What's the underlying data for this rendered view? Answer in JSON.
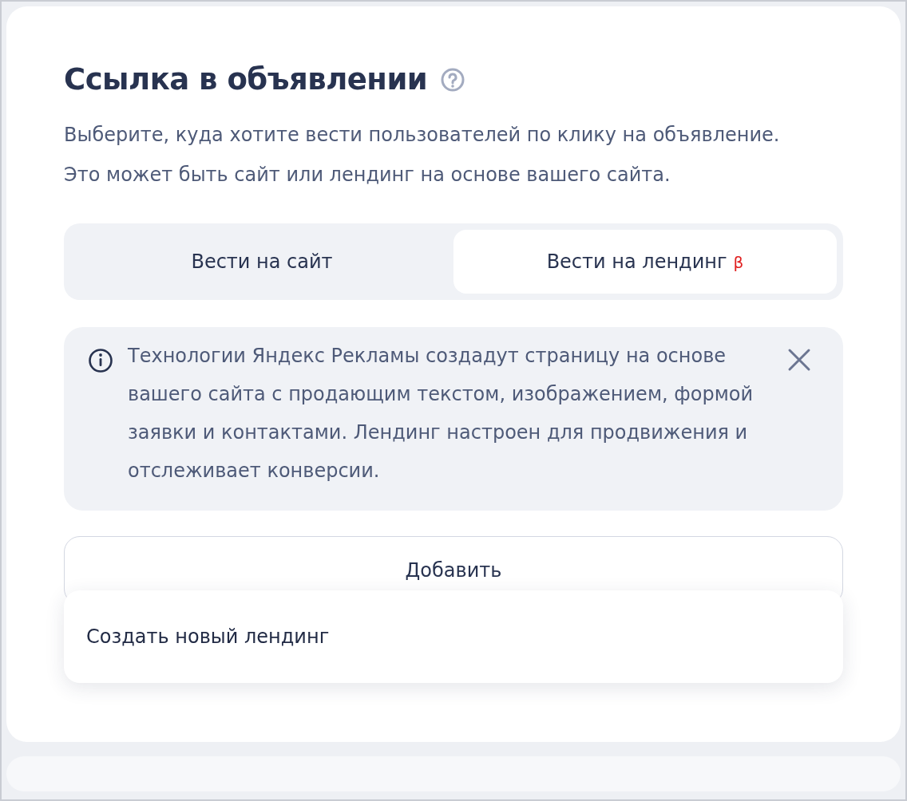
{
  "title": "Ссылка в объявлении",
  "description": "Выберите, куда хотите вести пользователей по клику на объявление. Это может быть сайт или лендинг на основе вашего сайта.",
  "mode_tabs": [
    {
      "label": "Вести на сайт",
      "selected": false
    },
    {
      "label": "Вести на лендинг",
      "selected": true,
      "badge": "β"
    }
  ],
  "info": {
    "text": "Технологии Яндекс Рекламы создадут страницу на основе вашего сайта с продающим текстом, изображением, формой заявки и контактами. Лендинг настроен для продвижения и отслеживает конверсии."
  },
  "add_button": {
    "label": "Добавить",
    "expanded": true
  },
  "menu": {
    "items": [
      {
        "label": "Создать новый лендинг"
      }
    ]
  }
}
